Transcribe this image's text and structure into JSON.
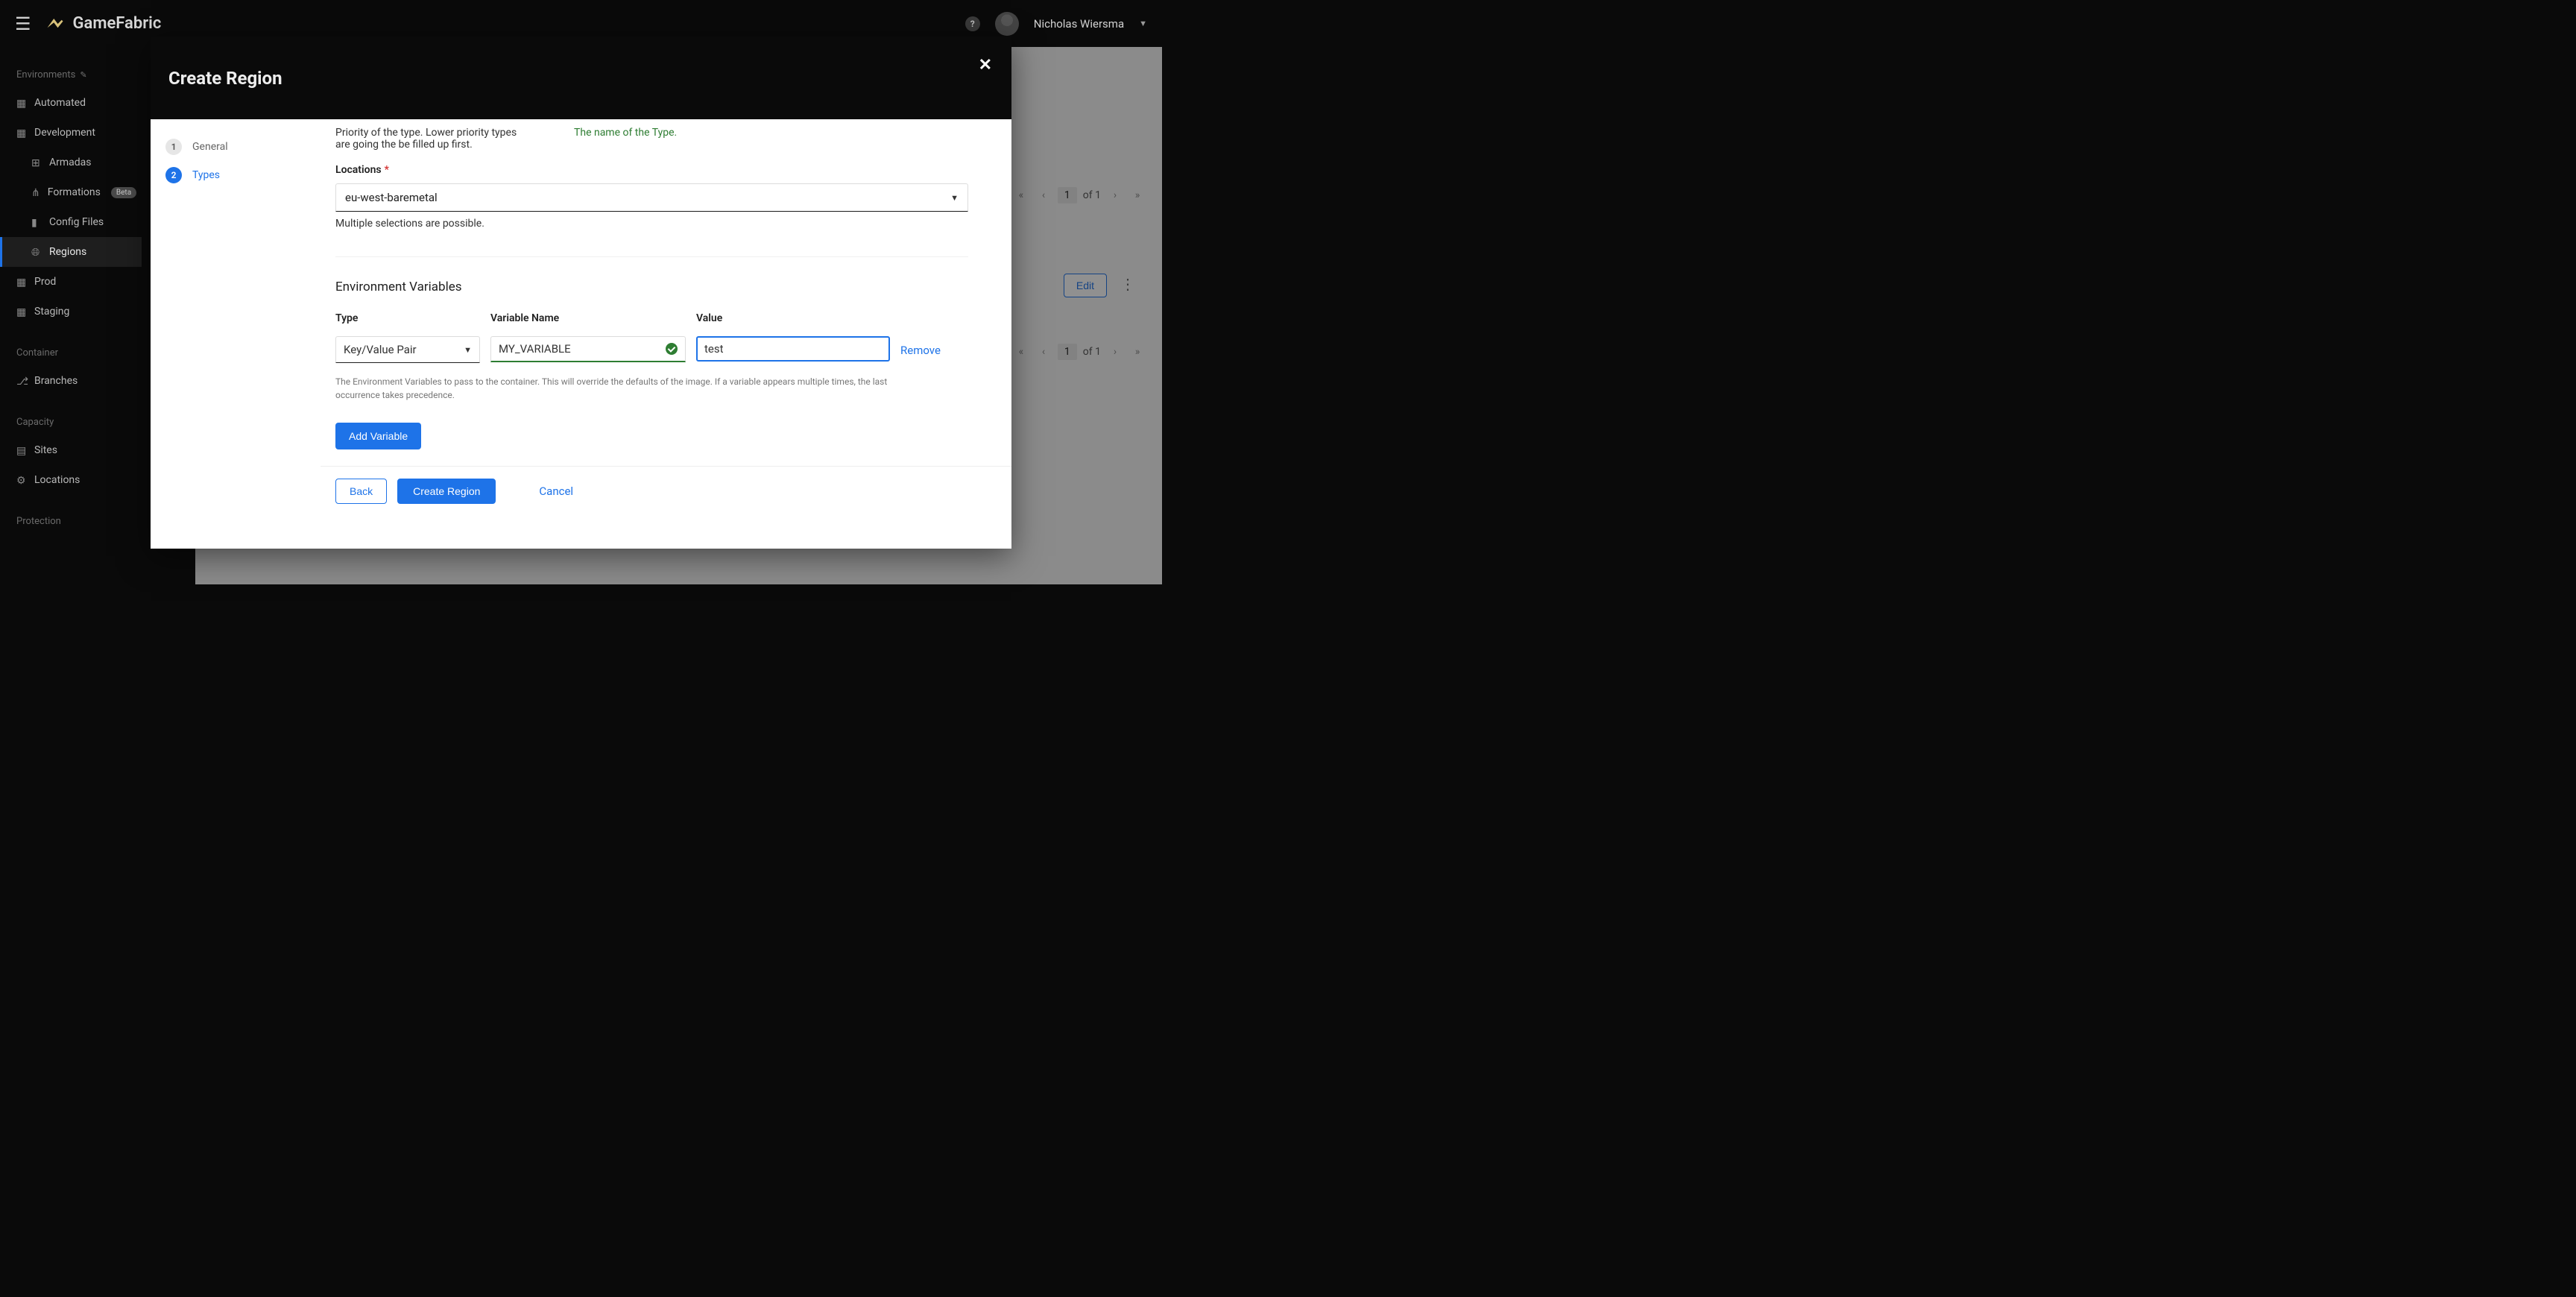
{
  "brand": {
    "name": "GameFabric"
  },
  "user": {
    "name": "Nicholas Wiersma"
  },
  "sidebar": {
    "environments_label": "Environments",
    "items": [
      {
        "label": "Automated"
      },
      {
        "label": "Development"
      },
      {
        "label": "Armadas"
      },
      {
        "label": "Formations",
        "badge": "Beta"
      },
      {
        "label": "Config Files"
      },
      {
        "label": "Regions"
      },
      {
        "label": "Prod"
      },
      {
        "label": "Staging"
      }
    ],
    "container_label": "Container",
    "container_items": [
      {
        "label": "Branches"
      }
    ],
    "capacity_label": "Capacity",
    "capacity_items": [
      {
        "label": "Sites"
      },
      {
        "label": "Locations"
      }
    ],
    "protection_label": "Protection"
  },
  "bg": {
    "edit": "Edit",
    "paginator": {
      "current": "1",
      "of": "of 1"
    }
  },
  "modal": {
    "title": "Create Region",
    "steps": [
      {
        "num": "1",
        "label": "General"
      },
      {
        "num": "2",
        "label": "Types"
      }
    ],
    "priority_help_left": "Priority of the type. Lower priority types are going the be filled up first.",
    "priority_help_right": "The name of the Type.",
    "locations_label": "Locations",
    "locations_value": "eu-west-baremetal",
    "locations_hint": "Multiple selections are possible.",
    "env_title": "Environment Variables",
    "columns": {
      "type": "Type",
      "name": "Variable Name",
      "value": "Value"
    },
    "row": {
      "type": "Key/Value Pair",
      "name": "MY_VARIABLE",
      "value": "test",
      "remove": "Remove"
    },
    "env_hint": "The Environment Variables to pass to the container. This will override the defaults of the image. If a variable appears multiple times, the last occurrence takes precedence.",
    "add_var": "Add Variable",
    "footer": {
      "back": "Back",
      "create": "Create Region",
      "cancel": "Cancel"
    }
  }
}
